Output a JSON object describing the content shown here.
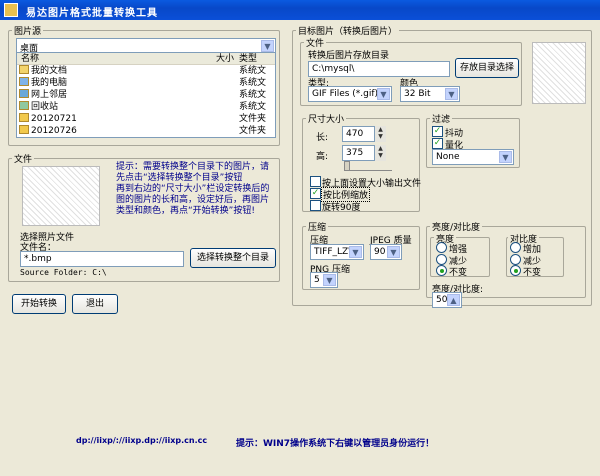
{
  "app": {
    "title": "易达图片格式批量转换工具"
  },
  "source": {
    "group_label": "图片源",
    "drive": "桌面",
    "headers": {
      "name": "名称",
      "size": "大小",
      "type": "类型"
    },
    "items": [
      {
        "name": "我的文档",
        "type": "系统文"
      },
      {
        "name": "我的电脑",
        "type": "系统文"
      },
      {
        "name": "网上邻居",
        "type": "系统文"
      },
      {
        "name": "回收站",
        "type": "系统文"
      },
      {
        "name": "20120721",
        "type": "文件夹"
      },
      {
        "name": "20120726",
        "type": "文件夹"
      }
    ]
  },
  "file": {
    "group_label": "文件",
    "hint": "提示：需要转换整个目录下的图片，请先点击“选择转换整个目录”按钮\n再到右边的“尺寸大小”栏设定转换后的图的图片的长和高，设定好后，再图片类型和颜色，再点“开始转换”按钮!",
    "select_file_label": "选择照片文件",
    "filename_label": "文件名：",
    "filename_value": "*.bmp",
    "select_dir_button": "选择转换整个目录",
    "source_folder": "Source Folder: C:\\"
  },
  "actions": {
    "start": "开始转换",
    "exit": "退出"
  },
  "target": {
    "group_label": "目标图片（转换后图片）",
    "file_label": "文件",
    "save_dir_label": "转换后图片存放目录",
    "save_dir_value": "C:\\mysql\\",
    "save_dir_button": "存放目录选择",
    "type_label": "类型:",
    "type_value": "GIF Files (*.gif)",
    "color_label": "颜色",
    "color_value": "32 Bit"
  },
  "size": {
    "group_label": "尺寸大小",
    "width_label": "长:",
    "width_value": "470",
    "height_label": "高:",
    "height_value": "375",
    "opt_dir_out": "按上面设置大小输出文件",
    "opt_ratio": "按比例缩放",
    "opt_rotate": "旋转90度"
  },
  "filter": {
    "group_label": "过滤",
    "dither": "抖动",
    "quant": "量化",
    "none_value": "None"
  },
  "compress": {
    "group_label": "压缩",
    "ratio_label": "压缩",
    "ratio_value": "TIFF_LZW",
    "jpeg_label": "JPEG 质量",
    "jpeg_value": "90",
    "png_label": "PNG 压缩",
    "png_value": "5"
  },
  "bc": {
    "group_label": "亮度/对比度",
    "bright_label": "亮度",
    "inc": "增强",
    "dec": "减少",
    "none": "不变",
    "contrast_label": "对比度",
    "c_inc": "增加",
    "c_dec": "减少",
    "c_none": "不变",
    "field_label": "亮度/对比度:",
    "field_value": "50"
  },
  "footer": {
    "url": "dp://iixp/://iixp.dp://iixp.cn.cc",
    "tip": "提示：WIN7操作系统下右键以管理员身份运行！"
  },
  "colors": {
    "title_blue": "#0a5ae0",
    "hint_blue": "#00008b"
  }
}
